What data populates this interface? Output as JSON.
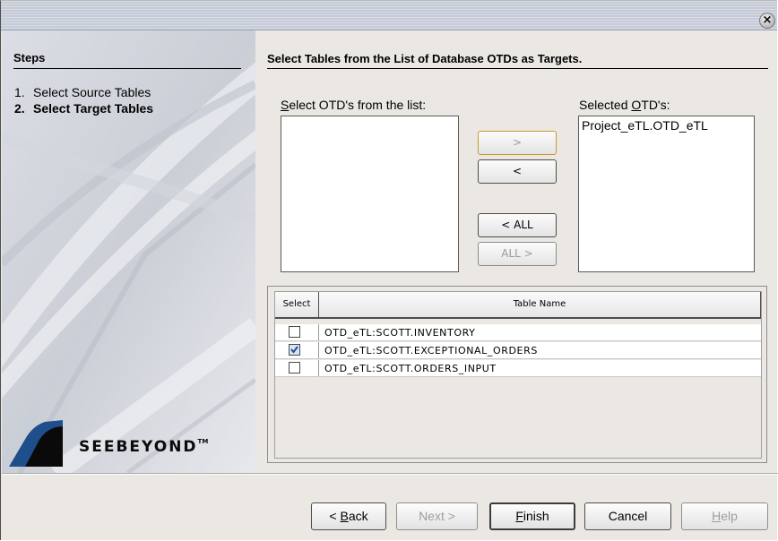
{
  "window": {
    "close_icon": "close-icon"
  },
  "steps": {
    "title": "Steps",
    "items": [
      {
        "num": "1.",
        "label": "Select Source Tables",
        "active": false
      },
      {
        "num": "2.",
        "label": "Select Target Tables",
        "active": true
      }
    ],
    "logo_text": "SEEBEYOND",
    "logo_tm": "TM"
  },
  "main": {
    "title": "Select Tables from the List of Database OTDs as Targets.",
    "available_label_prefix": "S",
    "available_label_rest": "elect OTD's from the list:",
    "selected_label_prefix": "Selected ",
    "selected_label_mn": "O",
    "selected_label_rest": "TD's:",
    "available_items": [],
    "selected_items": [
      "Project_eTL.OTD_eTL"
    ],
    "buttons": {
      "add": ">",
      "remove": "<",
      "remove_all": "< ALL",
      "add_all": "ALL >"
    }
  },
  "table": {
    "columns": [
      "Select",
      "Table Name"
    ],
    "rows": [
      {
        "checked": false,
        "name": "OTD_eTL:SCOTT.INVENTORY"
      },
      {
        "checked": true,
        "name": "OTD_eTL:SCOTT.EXCEPTIONAL_ORDERS"
      },
      {
        "checked": false,
        "name": "OTD_eTL:SCOTT.ORDERS_INPUT"
      }
    ]
  },
  "footer": {
    "back_prefix": "< ",
    "back_mn": "B",
    "back_rest": "ack",
    "next": "Next >",
    "finish_mn": "F",
    "finish_rest": "inish",
    "cancel": "Cancel",
    "help_mn": "H",
    "help_rest": "elp"
  },
  "colors": {
    "panel_bg": "#ebe8e4",
    "focus_border": "#c79a2f",
    "logo_blue": "#1f4e8c"
  }
}
